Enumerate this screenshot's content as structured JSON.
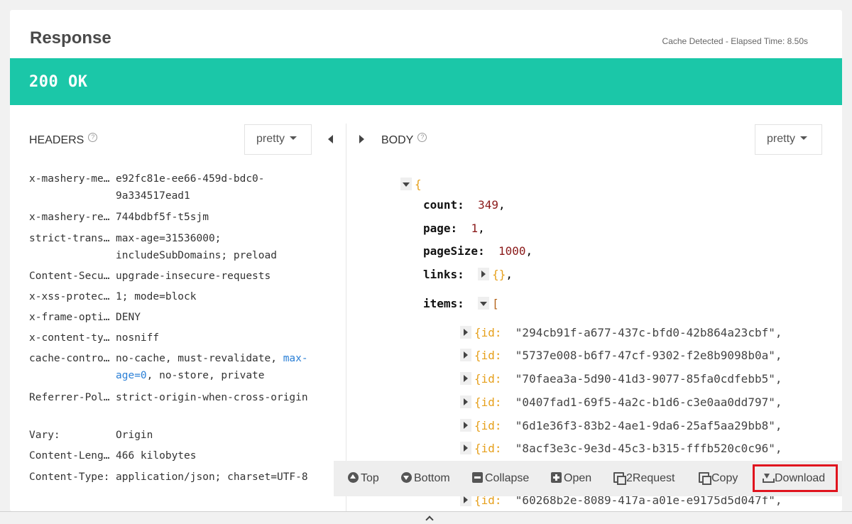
{
  "response": {
    "title": "Response",
    "cache_info": "Cache Detected - Elapsed Time: 8.50s",
    "status": "200 OK"
  },
  "headers": {
    "label": "HEADERS",
    "help": "?",
    "format": "pretty",
    "rows": [
      {
        "key": "x-mashery-me…",
        "value": "e92fc81e-ee66-459d-bdc0-9a334517ead1"
      },
      {
        "key": "x-mashery-re…",
        "value": "744bdbf5f-t5sjm"
      },
      {
        "key": "strict-trans…",
        "value": "max-age=31536000; includeSubDomains; preload"
      },
      {
        "key": "Content-Secu…",
        "value": "upgrade-insecure-requests"
      },
      {
        "key": "x-xss-protec…",
        "value": "1; mode=block"
      },
      {
        "key": "x-frame-opti…",
        "value": "DENY"
      },
      {
        "key": "x-content-ty…",
        "value": "nosniff"
      },
      {
        "key": "cache-contro…",
        "value_a": "no-cache, must-revalidate, ",
        "value_b": "max-age=0",
        "value_c": ", no-store, private"
      },
      {
        "key": "Referrer-Pol…",
        "value": "strict-origin-when-cross-origin"
      },
      {
        "key": "Vary:",
        "value": "Origin"
      },
      {
        "key": "Content-Leng…",
        "value": "466 kilobytes"
      },
      {
        "key": "Content-Type:",
        "value": "application/json; charset=UTF-8"
      }
    ]
  },
  "body": {
    "label": "BODY",
    "help": "?",
    "format": "pretty",
    "open_brace": "{",
    "fields": {
      "count_key": "count:",
      "count_val": "349",
      "page_key": "page:",
      "page_val": "1",
      "pagesize_key": "pageSize:",
      "pagesize_val": "1000",
      "links_key": "links:",
      "links_val": "{}",
      "items_key": "items:",
      "items_open": "["
    },
    "comma": ",",
    "item_prefix": "{id:",
    "items": [
      "\"294cb91f-a677-437c-bfd0-42b864a23cbf\",",
      "\"5737e008-b6f7-47cf-9302-f2e8b9098b0a\",",
      "\"70faea3a-5d90-41d3-9077-85fa0cdfebb5\",",
      "\"0407fad1-69f5-4a2c-b1d6-c3e0aa0dd797\",",
      "\"6d1e36f3-83b2-4ae1-9da6-25af5aa29bb8\",",
      "\"8acf3e3c-9e3d-45c3-b315-fffb520c0c96\",",
      "\"60268b2e-8089-417a-a01e-e9175d5d047f\","
    ]
  },
  "toolbar": {
    "top": "Top",
    "bottom": "Bottom",
    "collapse": "Collapse",
    "open": "Open",
    "to_request": "2Request",
    "copy": "Copy",
    "download": "Download"
  }
}
